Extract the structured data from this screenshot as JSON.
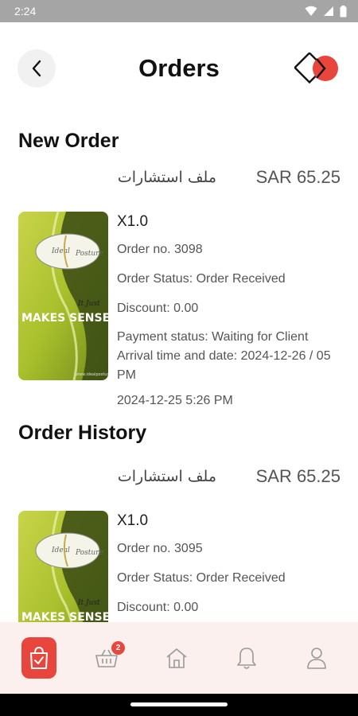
{
  "status_bar": {
    "time": "2:24"
  },
  "header": {
    "title": "Orders"
  },
  "sections": {
    "new_order_title": "New Order",
    "history_title": "Order History"
  },
  "new_order": {
    "name": "ملف استشارات",
    "price": "SAR 65.25",
    "quantity": "X1.0",
    "order_no": "Order no. 3098",
    "status": "Order Status: Order Received",
    "discount": "Discount: 0.00",
    "payment_status": "Payment status: Waiting for Client",
    "arrival": "Arrival time and date: 2024-12-26 / 05 PM",
    "date": "2024-12-25 5:26 PM",
    "thumb_text": "MAKES SENSE"
  },
  "history_order": {
    "name": "ملف استشارات",
    "price": "SAR 65.25",
    "quantity": "X1.0",
    "order_no": "Order no. 3095",
    "status": "Order Status: Order Received",
    "discount": "Discount: 0.00",
    "thumb_text": "MAKES SENSE"
  },
  "bottom_nav": {
    "items": [
      {
        "icon": "shopping-bag-check-icon",
        "active": true
      },
      {
        "icon": "basket-icon",
        "badge": "2"
      },
      {
        "icon": "home-icon"
      },
      {
        "icon": "bell-icon"
      },
      {
        "icon": "user-icon"
      }
    ]
  },
  "colors": {
    "accent": "#e8453c",
    "nav_bg": "#fbf0ee",
    "status_bar": "#a5a5a5"
  }
}
